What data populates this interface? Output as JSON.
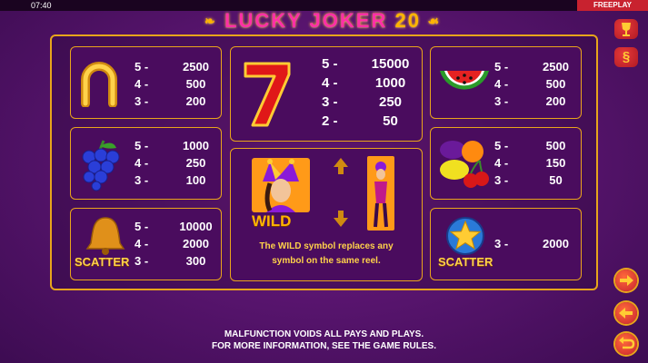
{
  "status_bar": {
    "time": "07:40",
    "mode": "FREEPLAY"
  },
  "title": {
    "main": "LUCKY JOKER",
    "number": "20"
  },
  "symbols": {
    "horseshoe": {
      "pays": [
        [
          "5 -",
          "2500"
        ],
        [
          "4 -",
          "500"
        ],
        [
          "3 -",
          "200"
        ]
      ]
    },
    "seven": {
      "pays": [
        [
          "5 -",
          "15000"
        ],
        [
          "4 -",
          "1000"
        ],
        [
          "3 -",
          "250"
        ],
        [
          "2 -",
          "50"
        ]
      ]
    },
    "watermelon": {
      "pays": [
        [
          "5 -",
          "2500"
        ],
        [
          "4 -",
          "500"
        ],
        [
          "3 -",
          "200"
        ]
      ]
    },
    "grapes": {
      "pays": [
        [
          "5 -",
          "1000"
        ],
        [
          "4 -",
          "250"
        ],
        [
          "3 -",
          "100"
        ]
      ]
    },
    "fruits": {
      "pays": [
        [
          "5 -",
          "500"
        ],
        [
          "4 -",
          "150"
        ],
        [
          "3 -",
          "50"
        ]
      ]
    },
    "bell_scatter": {
      "label": "SCATTER",
      "pays": [
        [
          "5 -",
          "10000"
        ],
        [
          "4 -",
          "2000"
        ],
        [
          "3 -",
          "300"
        ]
      ]
    },
    "star_scatter": {
      "label": "SCATTER",
      "pays": [
        [
          "3 -",
          "2000"
        ]
      ]
    }
  },
  "wild": {
    "label": "WILD",
    "description_line1": "The WILD symbol replaces any",
    "description_line2": "symbol on the same reel."
  },
  "footer": {
    "line1": "MALFUNCTION VOIDS ALL PAYS AND PLAYS.",
    "line2": "FOR MORE INFORMATION, SEE THE GAME RULES."
  },
  "colors": {
    "accent": "#e9a51b",
    "brand_pink": "#ff2fa8",
    "panel": "#4a0c5e",
    "button_red": "#c8222f"
  },
  "icons": {
    "trophy": "trophy-icon",
    "rules": "section-sign-icon",
    "next": "arrow-right-icon",
    "prev": "arrow-left-icon",
    "back": "return-arrow-icon"
  }
}
